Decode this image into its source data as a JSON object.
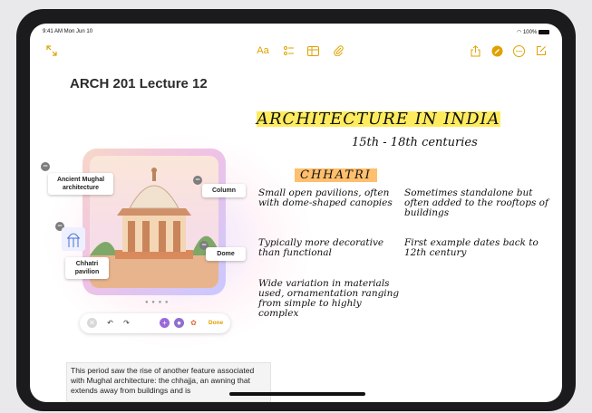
{
  "status": {
    "time": "9:41 AM  Mon Jun 10",
    "battery": "100%"
  },
  "toolbar": {
    "collapse_icon": "collapse-arrows-icon",
    "format_label": "Aa",
    "checklist_icon": "checklist-icon",
    "table_icon": "table-icon",
    "attach_icon": "paperclip-icon",
    "share_icon": "share-icon",
    "markup_icon": "pen-circle-icon",
    "more_icon": "ellipsis-icon",
    "compose_icon": "compose-icon",
    "accent": "#e0a100"
  },
  "note": {
    "title": "ARCH 201 Lecture 12",
    "callouts": {
      "mughal": "Ancient Mughal architecture",
      "column": "Column",
      "dome": "Dome",
      "chhatri": "Chhatri pavilion"
    },
    "image_controls": {
      "done_label": "Done",
      "done_color": "#e0a100"
    },
    "body_text": "This period saw the rise of another feature associated with Mughal architecture: the chhajja, an awning that extends away from buildings and is"
  },
  "handwriting": {
    "heading": "ARCHITECTURE IN INDIA",
    "subheading": "15th - 18th centuries",
    "section": "CHHATRI",
    "bullets_left": [
      "Small open pavilions, often with dome-shaped canopies",
      "Typically more decorative than functional",
      "Wide variation in materials used, ornamentation ranging from simple to highly complex"
    ],
    "bullets_right": [
      "Sometimes standalone but often added to the rooftops of buildings",
      "First example dates back to 12th century"
    ]
  }
}
